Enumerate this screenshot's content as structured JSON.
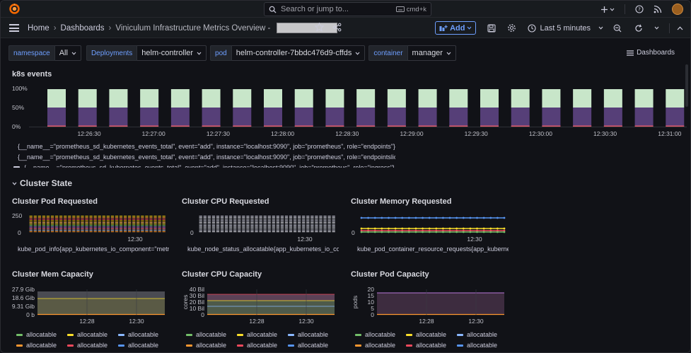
{
  "search": {
    "placeholder": "Search or jump to...",
    "shortcut": "cmd+k"
  },
  "breadcrumbs": {
    "home": "Home",
    "dashboards": "Dashboards",
    "current": "Viniculum Infrastructure Metrics Overview -"
  },
  "toolbar": {
    "add_label": "Add",
    "time_range": "Last 5 minutes"
  },
  "variables": [
    {
      "label": "namespace",
      "value": "All"
    },
    {
      "label": "Deployments",
      "value": "helm-controller"
    },
    {
      "label": "pod",
      "value": "helm-controller-7bbdc476d9-cffds"
    },
    {
      "label": "container",
      "value": "manager"
    }
  ],
  "dashboards_link": "Dashboards",
  "k8s_panel": {
    "title": "k8s events",
    "y_ticks": [
      "100%",
      "50%",
      "0%"
    ],
    "x_ticks": [
      "12:26:30",
      "12:27:00",
      "12:27:30",
      "12:28:00",
      "12:28:30",
      "12:29:00",
      "12:29:30",
      "12:30:00",
      "12:30:30",
      "12:31:00"
    ],
    "legend": [
      {
        "text": "{__name__=\"prometheus_sd_kubernetes_events_total\", event=\"add\", instance=\"localhost:9090\", job=\"prometheus\", role=\"endpoints\"}",
        "color": "#73bf69"
      },
      {
        "text": "{__name__=\"prometheus_sd_kubernetes_events_total\", event=\"add\", instance=\"localhost:9090\", job=\"prometheus\", role=\"endpointslice\"}",
        "color": "#fade2a"
      },
      {
        "text": "{__name__=\"prometheus_sd_kubernetes_events_total\", event=\"add\", instance=\"localhost:9090\", job=\"prometheus\", role=\"ingress\"}",
        "color": "#ccccdc"
      }
    ]
  },
  "section_title": "Cluster State",
  "panels": {
    "pod_requested": {
      "title": "Cluster Pod Requested",
      "y_ticks": [
        "250",
        "0"
      ],
      "x_tick": "12:30",
      "legend": "kube_pod_info{app_kubernetes_io_component=\"metrics\"}"
    },
    "cpu_requested": {
      "title": "Cluster CPU Requested",
      "y_ticks": [
        "0"
      ],
      "x_tick": "12:30",
      "legend": "kube_node_status_allocatable{app_kubernetes_io_component=\"metrics\"}"
    },
    "mem_requested": {
      "title": "Cluster Memory Requested",
      "y_ticks": [
        "0"
      ],
      "x_tick": "12:30",
      "legend": "kube_pod_container_resource_requests{app_kubernetes_io_component=\"metrics\"}"
    },
    "mem_capacity": {
      "title": "Cluster Mem Capacity",
      "y_ticks": [
        "27.9 Gib",
        "18.6 Gib",
        "9.31 Gib",
        "0 b"
      ],
      "x_ticks": [
        "12:28",
        "12:30"
      ]
    },
    "cpu_capacity": {
      "title": "Cluster CPU Capacity",
      "y_ticks": [
        "40 Bil",
        "30 Bil",
        "20 Bil",
        "10 Bil",
        "0"
      ],
      "y_label": "cores",
      "x_ticks": [
        "12:28",
        "12:30"
      ]
    },
    "pod_capacity": {
      "title": "Cluster Pod Capacity",
      "y_ticks": [
        "20",
        "15",
        "10",
        "5",
        "0"
      ],
      "y_label": "pods",
      "x_ticks": [
        "12:28",
        "12:30"
      ]
    }
  },
  "capacity_legend": {
    "label": "allocatable",
    "colors": [
      "#73bf69",
      "#fade2a",
      "#8ab8ff",
      "#ff9830",
      "#f2495c",
      "#5794f2"
    ]
  },
  "colors": {
    "accent": "#6e9fff",
    "bg": "#111217",
    "panel_bar_top": "#c8e6c9",
    "panel_bar_bottom": "#5a3e7a"
  }
}
